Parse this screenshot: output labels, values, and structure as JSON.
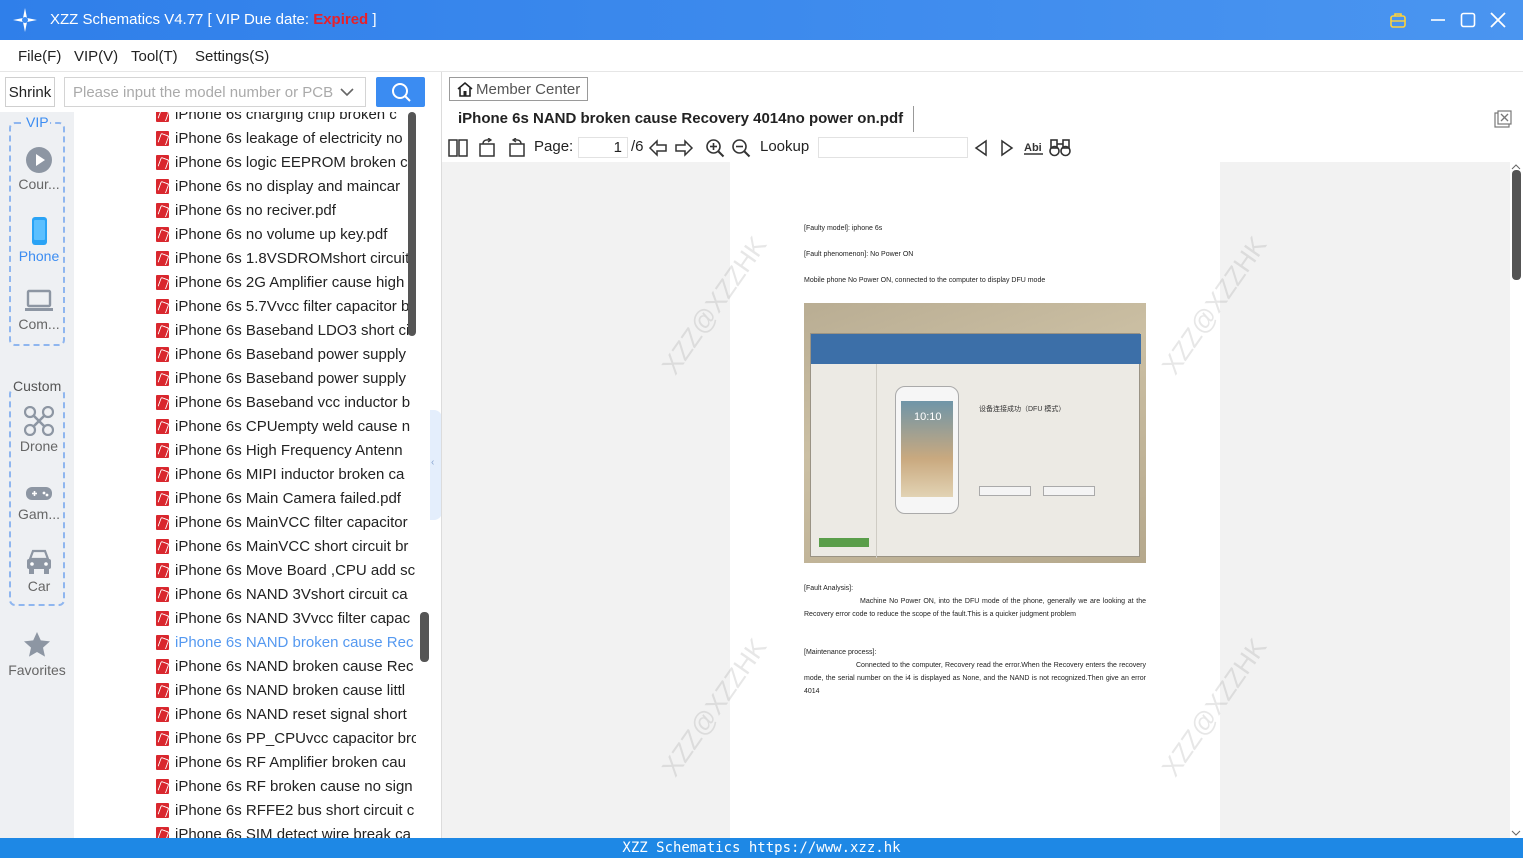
{
  "window": {
    "title_prefix": "XZZ Schematics V4.77 [ VIP Due date: ",
    "title_status": "Expired",
    "title_suffix": " ]"
  },
  "menu": [
    "File(F)",
    "VIP(V)",
    "Tool(T)",
    "Settings(S)"
  ],
  "sidebar_top": {
    "shrink_label": "Shrink",
    "search_placeholder": "Please input the model number or PCB"
  },
  "categories": {
    "vip_label": "VIP",
    "custom_label": "Custom",
    "vip_items": [
      {
        "label": "Cour...",
        "icon": "play-circle-icon"
      },
      {
        "label": "Phone",
        "icon": "phone-icon"
      },
      {
        "label": "Com...",
        "icon": "laptop-icon"
      }
    ],
    "custom_items": [
      {
        "label": "Drone",
        "icon": "drone-icon"
      },
      {
        "label": "Gam...",
        "icon": "gamepad-icon"
      },
      {
        "label": "Car",
        "icon": "car-icon"
      }
    ],
    "favorites_label": "Favorites"
  },
  "file_list": {
    "selected_index": 22,
    "items": [
      "iPhone 6s  charging chip broken c",
      "iPhone 6s  leakage of electricity no",
      "iPhone 6s  logic EEPROM broken c",
      "iPhone 6s  no display and maincar",
      "iPhone 6s  no reciver.pdf",
      "iPhone 6s  no volume up key.pdf",
      "iPhone 6s 1.8VSDROMshort circuit",
      "iPhone 6s 2G Amplifier cause high",
      "iPhone 6s 5.7Vvcc filter capacitor b",
      "iPhone 6s Baseband LDO3 short ci",
      "iPhone 6s Baseband power supply",
      "iPhone 6s Baseband power supply",
      "iPhone 6s Baseband vcc inductor b",
      "iPhone 6s CPUempty weld cause n",
      "iPhone 6s High Frequency Antenn",
      "iPhone 6s MIPI inductor broken ca",
      "iPhone 6s Main Camera failed.pdf",
      "iPhone 6s MainVCC filter capacitor",
      "iPhone 6s MainVCC short circuit br",
      "iPhone 6s Move Board ,CPU add sc",
      "iPhone 6s NAND 3Vshort circuit ca",
      "iPhone 6s NAND 3Vvcc filter capac",
      "iPhone 6s NAND broken cause Rec",
      "iPhone 6s NAND broken cause Rec",
      "iPhone 6s NAND broken cause littl",
      "iPhone 6s NAND reset signal short",
      "iPhone 6s PP_CPUvcc capacitor bro",
      "iPhone 6s RF Amplifier broken cau",
      "iPhone 6s RF broken cause no sign",
      "iPhone 6s RFFE2 bus short circuit c",
      "iPhone 6s SIM detect wire break ca"
    ]
  },
  "viewer": {
    "member_center": "Member Center",
    "document_title": "iPhone 6s NAND broken cause Recovery 4014no power on.pdf",
    "page_label": "Page:",
    "current_page": "1",
    "total_pages": "/6",
    "lookup_label": "Lookup",
    "lookup_value": "",
    "watermark": "XZZ@XZZHK"
  },
  "pdf_page": {
    "faulty_model": "[Faulty model]: iphone 6s",
    "fault_phenomenon": "[Fault phenomenon]: No Power ON",
    "summary": "Mobile phone No Power ON, connected to the computer to display DFU mode",
    "fault_analysis_heading": "[Fault Analysis]:",
    "fault_analysis_text": "Machine No Power ON, into the DFU mode of the phone, generally we are looking at the Recovery error code to reduce the scope of the fault.This is a quicker judgment problem",
    "maintenance_heading": "[Maintenance process]:",
    "maintenance_text": "Connected to the computer, Recovery read the error.When the Recovery enters the recovery mode, the serial number on the i4 is displayed as None, and the NAND is not recognized.Then give an error 4014",
    "photo": {
      "title": "设备连接成功（DFU 模式）",
      "clock": "10:10"
    }
  },
  "status_bar": "XZZ Schematics https://www.xzz.hk"
}
